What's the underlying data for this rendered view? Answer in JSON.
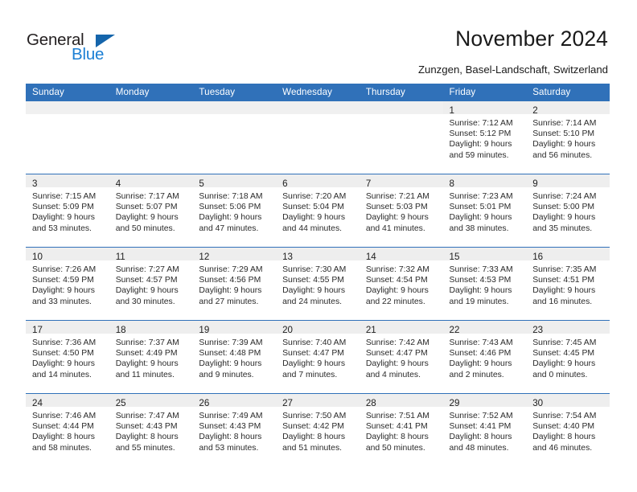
{
  "brand": {
    "name_part1": "General",
    "name_part2": "Blue",
    "triangle_color": "#1565ab",
    "blue_color": "#1b7fd4"
  },
  "header": {
    "title": "November 2024",
    "subtitle": "Zunzgen, Basel-Landschaft, Switzerland",
    "accent_color": "#3071b9"
  },
  "weekdays": [
    "Sunday",
    "Monday",
    "Tuesday",
    "Wednesday",
    "Thursday",
    "Friday",
    "Saturday"
  ],
  "weeks": [
    [
      {
        "day": "",
        "empty": true
      },
      {
        "day": "",
        "empty": true
      },
      {
        "day": "",
        "empty": true
      },
      {
        "day": "",
        "empty": true
      },
      {
        "day": "",
        "empty": true
      },
      {
        "day": "1",
        "sunrise": "Sunrise: 7:12 AM",
        "sunset": "Sunset: 5:12 PM",
        "daylight1": "Daylight: 9 hours",
        "daylight2": "and 59 minutes."
      },
      {
        "day": "2",
        "sunrise": "Sunrise: 7:14 AM",
        "sunset": "Sunset: 5:10 PM",
        "daylight1": "Daylight: 9 hours",
        "daylight2": "and 56 minutes."
      }
    ],
    [
      {
        "day": "3",
        "sunrise": "Sunrise: 7:15 AM",
        "sunset": "Sunset: 5:09 PM",
        "daylight1": "Daylight: 9 hours",
        "daylight2": "and 53 minutes."
      },
      {
        "day": "4",
        "sunrise": "Sunrise: 7:17 AM",
        "sunset": "Sunset: 5:07 PM",
        "daylight1": "Daylight: 9 hours",
        "daylight2": "and 50 minutes."
      },
      {
        "day": "5",
        "sunrise": "Sunrise: 7:18 AM",
        "sunset": "Sunset: 5:06 PM",
        "daylight1": "Daylight: 9 hours",
        "daylight2": "and 47 minutes."
      },
      {
        "day": "6",
        "sunrise": "Sunrise: 7:20 AM",
        "sunset": "Sunset: 5:04 PM",
        "daylight1": "Daylight: 9 hours",
        "daylight2": "and 44 minutes."
      },
      {
        "day": "7",
        "sunrise": "Sunrise: 7:21 AM",
        "sunset": "Sunset: 5:03 PM",
        "daylight1": "Daylight: 9 hours",
        "daylight2": "and 41 minutes."
      },
      {
        "day": "8",
        "sunrise": "Sunrise: 7:23 AM",
        "sunset": "Sunset: 5:01 PM",
        "daylight1": "Daylight: 9 hours",
        "daylight2": "and 38 minutes."
      },
      {
        "day": "9",
        "sunrise": "Sunrise: 7:24 AM",
        "sunset": "Sunset: 5:00 PM",
        "daylight1": "Daylight: 9 hours",
        "daylight2": "and 35 minutes."
      }
    ],
    [
      {
        "day": "10",
        "sunrise": "Sunrise: 7:26 AM",
        "sunset": "Sunset: 4:59 PM",
        "daylight1": "Daylight: 9 hours",
        "daylight2": "and 33 minutes."
      },
      {
        "day": "11",
        "sunrise": "Sunrise: 7:27 AM",
        "sunset": "Sunset: 4:57 PM",
        "daylight1": "Daylight: 9 hours",
        "daylight2": "and 30 minutes."
      },
      {
        "day": "12",
        "sunrise": "Sunrise: 7:29 AM",
        "sunset": "Sunset: 4:56 PM",
        "daylight1": "Daylight: 9 hours",
        "daylight2": "and 27 minutes."
      },
      {
        "day": "13",
        "sunrise": "Sunrise: 7:30 AM",
        "sunset": "Sunset: 4:55 PM",
        "daylight1": "Daylight: 9 hours",
        "daylight2": "and 24 minutes."
      },
      {
        "day": "14",
        "sunrise": "Sunrise: 7:32 AM",
        "sunset": "Sunset: 4:54 PM",
        "daylight1": "Daylight: 9 hours",
        "daylight2": "and 22 minutes."
      },
      {
        "day": "15",
        "sunrise": "Sunrise: 7:33 AM",
        "sunset": "Sunset: 4:53 PM",
        "daylight1": "Daylight: 9 hours",
        "daylight2": "and 19 minutes."
      },
      {
        "day": "16",
        "sunrise": "Sunrise: 7:35 AM",
        "sunset": "Sunset: 4:51 PM",
        "daylight1": "Daylight: 9 hours",
        "daylight2": "and 16 minutes."
      }
    ],
    [
      {
        "day": "17",
        "sunrise": "Sunrise: 7:36 AM",
        "sunset": "Sunset: 4:50 PM",
        "daylight1": "Daylight: 9 hours",
        "daylight2": "and 14 minutes."
      },
      {
        "day": "18",
        "sunrise": "Sunrise: 7:37 AM",
        "sunset": "Sunset: 4:49 PM",
        "daylight1": "Daylight: 9 hours",
        "daylight2": "and 11 minutes."
      },
      {
        "day": "19",
        "sunrise": "Sunrise: 7:39 AM",
        "sunset": "Sunset: 4:48 PM",
        "daylight1": "Daylight: 9 hours",
        "daylight2": "and 9 minutes."
      },
      {
        "day": "20",
        "sunrise": "Sunrise: 7:40 AM",
        "sunset": "Sunset: 4:47 PM",
        "daylight1": "Daylight: 9 hours",
        "daylight2": "and 7 minutes."
      },
      {
        "day": "21",
        "sunrise": "Sunrise: 7:42 AM",
        "sunset": "Sunset: 4:47 PM",
        "daylight1": "Daylight: 9 hours",
        "daylight2": "and 4 minutes."
      },
      {
        "day": "22",
        "sunrise": "Sunrise: 7:43 AM",
        "sunset": "Sunset: 4:46 PM",
        "daylight1": "Daylight: 9 hours",
        "daylight2": "and 2 minutes."
      },
      {
        "day": "23",
        "sunrise": "Sunrise: 7:45 AM",
        "sunset": "Sunset: 4:45 PM",
        "daylight1": "Daylight: 9 hours",
        "daylight2": "and 0 minutes."
      }
    ],
    [
      {
        "day": "24",
        "sunrise": "Sunrise: 7:46 AM",
        "sunset": "Sunset: 4:44 PM",
        "daylight1": "Daylight: 8 hours",
        "daylight2": "and 58 minutes."
      },
      {
        "day": "25",
        "sunrise": "Sunrise: 7:47 AM",
        "sunset": "Sunset: 4:43 PM",
        "daylight1": "Daylight: 8 hours",
        "daylight2": "and 55 minutes."
      },
      {
        "day": "26",
        "sunrise": "Sunrise: 7:49 AM",
        "sunset": "Sunset: 4:43 PM",
        "daylight1": "Daylight: 8 hours",
        "daylight2": "and 53 minutes."
      },
      {
        "day": "27",
        "sunrise": "Sunrise: 7:50 AM",
        "sunset": "Sunset: 4:42 PM",
        "daylight1": "Daylight: 8 hours",
        "daylight2": "and 51 minutes."
      },
      {
        "day": "28",
        "sunrise": "Sunrise: 7:51 AM",
        "sunset": "Sunset: 4:41 PM",
        "daylight1": "Daylight: 8 hours",
        "daylight2": "and 50 minutes."
      },
      {
        "day": "29",
        "sunrise": "Sunrise: 7:52 AM",
        "sunset": "Sunset: 4:41 PM",
        "daylight1": "Daylight: 8 hours",
        "daylight2": "and 48 minutes."
      },
      {
        "day": "30",
        "sunrise": "Sunrise: 7:54 AM",
        "sunset": "Sunset: 4:40 PM",
        "daylight1": "Daylight: 8 hours",
        "daylight2": "and 46 minutes."
      }
    ]
  ]
}
